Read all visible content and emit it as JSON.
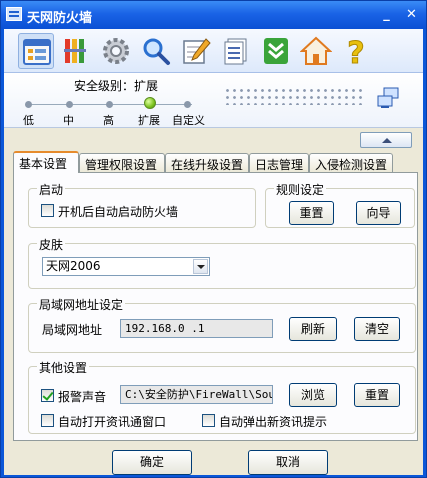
{
  "window": {
    "title": "天网防火墙"
  },
  "toolbar": {
    "icons": [
      "app-list-icon",
      "rules-bars-icon",
      "settings-gear-icon",
      "search-icon",
      "log-edit-icon",
      "report-document-icon",
      "download-arrows-icon",
      "home-icon",
      "help-question-icon"
    ]
  },
  "security": {
    "label": "安全级别：扩展",
    "levels": [
      "低",
      "中",
      "高",
      "扩展",
      "自定义"
    ],
    "current_index": 3
  },
  "tabs": [
    "基本设置",
    "管理权限设置",
    "在线升级设置",
    "日志管理",
    "入侵检测设置"
  ],
  "startup": {
    "title": "启动",
    "autostart_label": "开机后自动启动防火墙",
    "autostart_checked": false
  },
  "rules": {
    "title": "规则设定",
    "reset_label": "重置",
    "wizard_label": "向导"
  },
  "skin": {
    "title": "皮肤",
    "selected": "天网2006"
  },
  "lan": {
    "title": "局域网地址设定",
    "field_label": "局域网地址",
    "ip_value": "192.168.0  .1",
    "refresh_label": "刷新",
    "clear_label": "清空"
  },
  "other": {
    "title": "其他设置",
    "alarm_label": "报警声音",
    "alarm_checked": true,
    "sound_path": "C:\\安全防护\\FireWall\\Sour",
    "browse_label": "浏览",
    "reset_label": "重置",
    "auto_open_label": "自动打开资讯通窗口",
    "auto_open_checked": false,
    "auto_popup_label": "自动弹出新资讯提示",
    "auto_popup_checked": false
  },
  "footer": {
    "ok_label": "确定",
    "cancel_label": "取消"
  },
  "colors": {
    "titlebar": "#1a63e6",
    "accent_tab": "#e68b2c",
    "panel_bg": "#ece9d8"
  }
}
